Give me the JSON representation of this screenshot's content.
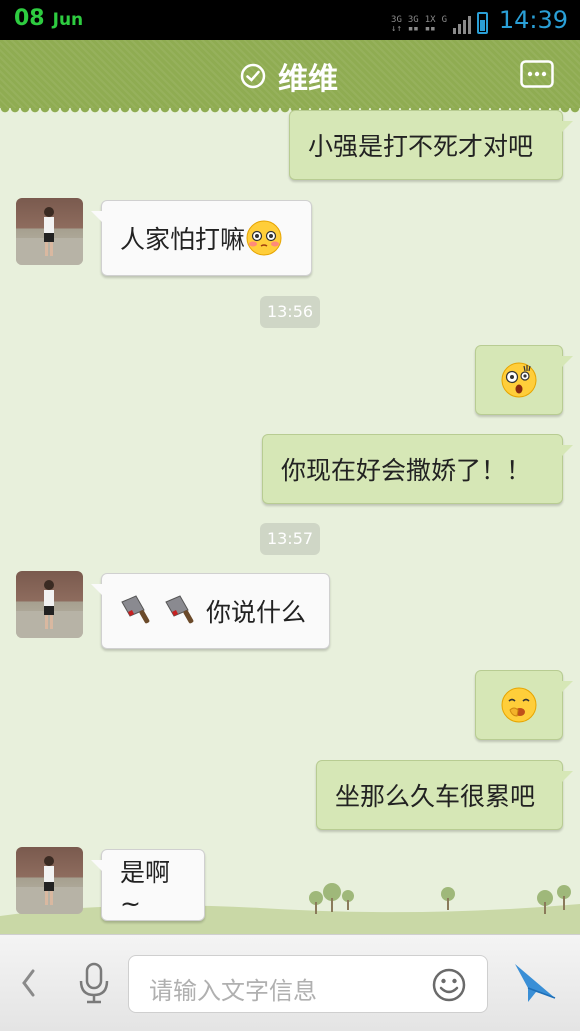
{
  "status_bar": {
    "day": "08",
    "month": "Jun",
    "network_labels": [
      "3G",
      "3G",
      "1X",
      "G"
    ],
    "time": "14:39",
    "colors": {
      "date": "#2ecc40",
      "time": "#2a9fd6"
    }
  },
  "header": {
    "title": "维维",
    "check_icon": "check-circle-icon",
    "more_icon": "more-icon"
  },
  "messages": [
    {
      "side": "right",
      "type": "text",
      "text": "小强是打不死才对吧"
    },
    {
      "side": "left",
      "type": "text",
      "text": "人家怕打嘛",
      "emoji": "shy-face-emoji"
    },
    {
      "type": "timestamp",
      "text": "13:56"
    },
    {
      "side": "right",
      "type": "emoji",
      "emoji": "shocked-face-emoji"
    },
    {
      "side": "right",
      "type": "text",
      "text": "你现在好会撒娇了！！"
    },
    {
      "type": "timestamp",
      "text": "13:57"
    },
    {
      "side": "left",
      "type": "text",
      "text": "你说什么",
      "emoji": "cleaver-emoji"
    },
    {
      "side": "right",
      "type": "emoji",
      "emoji": "yawn-face-emoji"
    },
    {
      "side": "right",
      "type": "text",
      "text": "坐那么久车很累吧"
    },
    {
      "side": "left",
      "type": "text",
      "text": "是啊~"
    }
  ],
  "input_bar": {
    "placeholder": "请输入文字信息",
    "back_icon": "chevron-left-icon",
    "mic_icon": "microphone-icon",
    "emoji_icon": "smiley-icon",
    "send_icon": "send-icon"
  },
  "colors": {
    "header_bg": "#8fac52",
    "chat_bg": "#e8f0dc",
    "bubble_sent": "#d6e7b6",
    "bubble_received": "#fafafa"
  }
}
